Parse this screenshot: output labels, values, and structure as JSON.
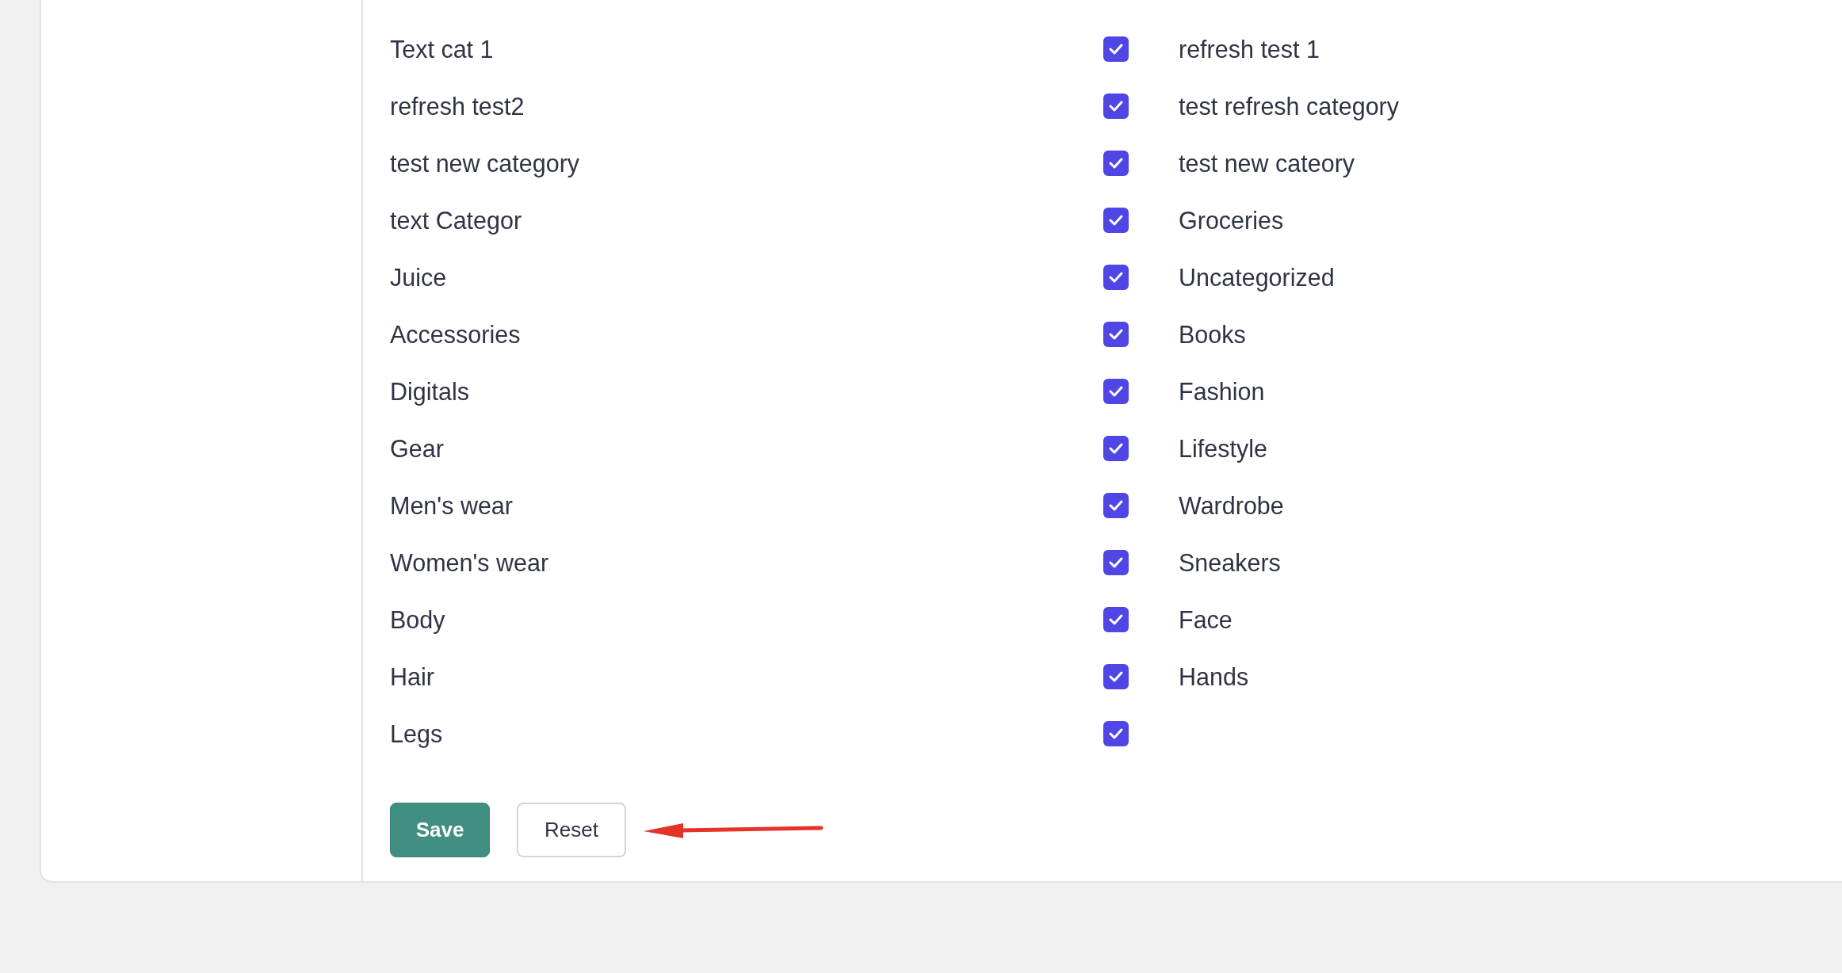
{
  "rows": [
    {
      "left": "Text cat 1",
      "checked": true,
      "right": "refresh test 1"
    },
    {
      "left": "refresh test2",
      "checked": true,
      "right": "test refresh category"
    },
    {
      "left": "test new category",
      "checked": true,
      "right": "test new cateory"
    },
    {
      "left": "text Categor",
      "checked": true,
      "right": "Groceries"
    },
    {
      "left": "Juice",
      "checked": true,
      "right": "Uncategorized"
    },
    {
      "left": "Accessories",
      "checked": true,
      "right": "Books"
    },
    {
      "left": "Digitals",
      "checked": true,
      "right": "Fashion"
    },
    {
      "left": "Gear",
      "checked": true,
      "right": "Lifestyle"
    },
    {
      "left": "Men's wear",
      "checked": true,
      "right": "Wardrobe"
    },
    {
      "left": "Women's wear",
      "checked": true,
      "right": "Sneakers"
    },
    {
      "left": "Body",
      "checked": true,
      "right": "Face"
    },
    {
      "left": "Hair",
      "checked": true,
      "right": "Hands"
    },
    {
      "left": "Legs",
      "checked": true
    }
  ],
  "buttons": [
    {
      "label": "Save",
      "kind": "primary"
    },
    {
      "label": "Reset",
      "kind": "secondary"
    }
  ]
}
